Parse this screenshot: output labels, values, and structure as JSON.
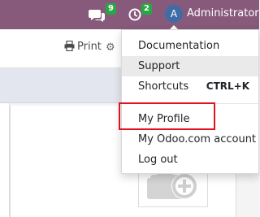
{
  "navbar": {
    "chat_count": "9",
    "activity_count": "2",
    "user_initial": "A",
    "user_name": "Administrator",
    "icons": {
      "messages": "chat-bubbles-icon",
      "activities": "clock-icon"
    }
  },
  "control_panel": {
    "print_label": "Print",
    "print_icon": "printer-icon",
    "action_icon": "gear-icon"
  },
  "user_dropdown": {
    "items": [
      {
        "label": "Documentation",
        "shortcut": ""
      },
      {
        "label": "Support",
        "shortcut": ""
      },
      {
        "label": "Shortcuts",
        "shortcut": "CTRL+K"
      },
      {
        "label": "My Profile",
        "shortcut": ""
      },
      {
        "label": "My Odoo.com account",
        "shortcut": ""
      },
      {
        "label": "Log out",
        "shortcut": ""
      }
    ],
    "hovered_item": "Support",
    "highlighted_item": "My Profile"
  },
  "form": {
    "image_placeholder_icon": "add-image-icon"
  },
  "colors": {
    "navbar": "#875a7b",
    "badge": "#28a745",
    "avatar": "#3f6ca4",
    "highlight": "#e0141e"
  }
}
